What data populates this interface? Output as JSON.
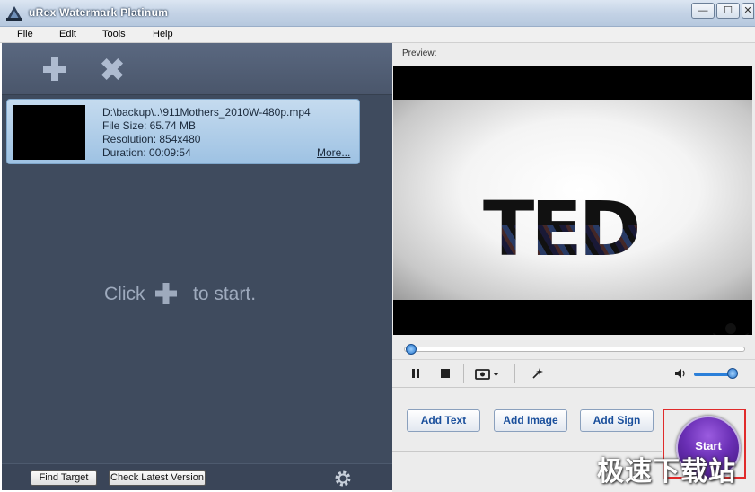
{
  "window": {
    "title": "uRex Watermark Platinum",
    "minimize_label": "—",
    "maximize_label": "☐",
    "close_label": "✕"
  },
  "menu": [
    "File",
    "Edit",
    "Tools",
    "Help"
  ],
  "file_list": {
    "items": [
      {
        "path": "D:\\backup\\..\\911Mothers_2010W-480p.mp4",
        "file_size": "File Size: 65.74 MB",
        "resolution": "Resolution: 854x480",
        "duration": "Duration: 00:09:54",
        "more_label": "More..."
      }
    ],
    "hint_before": "Click",
    "hint_after": "to start."
  },
  "footer": {
    "find_target": "Find Target",
    "check_version": "Check Latest Version"
  },
  "preview": {
    "label": "Preview:",
    "logo_text": "TED",
    "seek_progress": 0.02,
    "volume_level": 0.9
  },
  "actions": {
    "add_text": "Add Text",
    "add_image": "Add Image",
    "add_sign": "Add Sign",
    "start": "Start"
  },
  "site_watermark": "极速下载站",
  "icons": [
    "app-logo-icon",
    "add-icon",
    "remove-icon",
    "settings-icon",
    "pause-icon",
    "stop-icon",
    "snapshot-icon",
    "effect-icon",
    "volume-icon"
  ]
}
